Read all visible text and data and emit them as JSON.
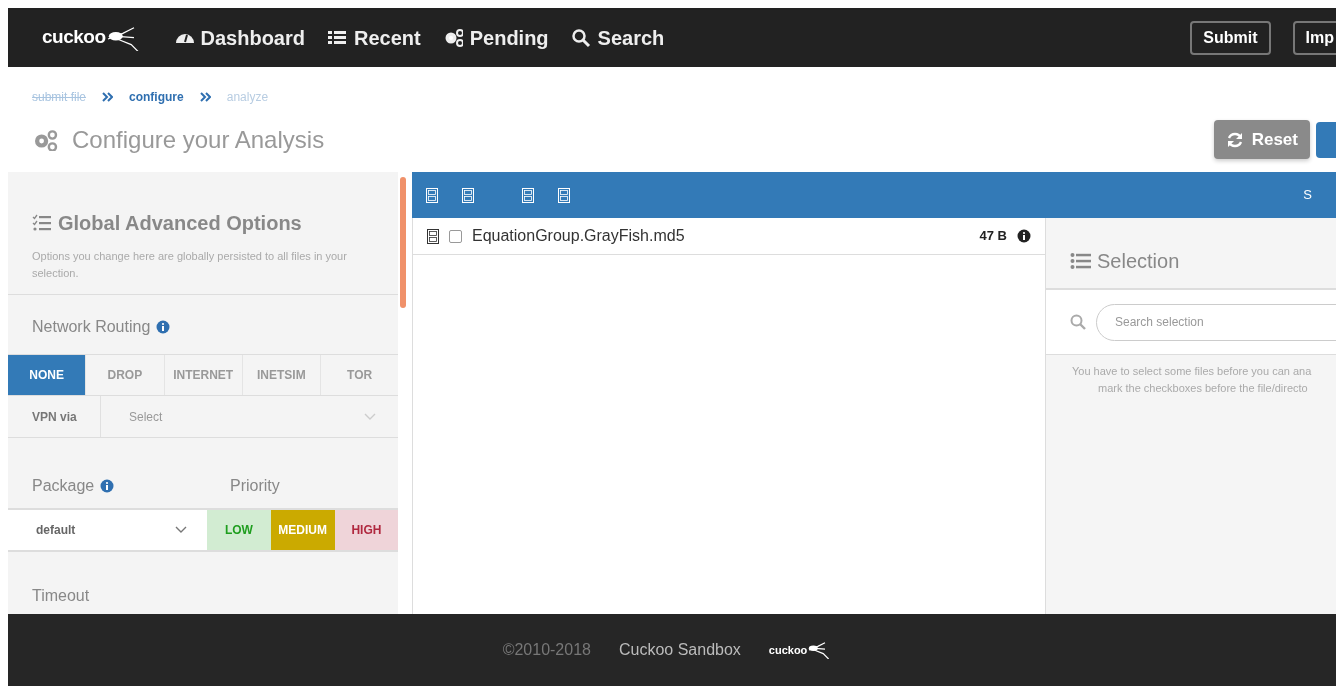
{
  "navbar": {
    "logo": "cuckoo",
    "items": [
      {
        "label": "Dashboard"
      },
      {
        "label": "Recent"
      },
      {
        "label": "Pending"
      },
      {
        "label": "Search"
      }
    ],
    "buttons": [
      "Submit",
      "Imp"
    ]
  },
  "breadcrumb": [
    {
      "label": "submit file",
      "done": true,
      "current": false
    },
    {
      "label": "configure",
      "done": false,
      "current": true
    },
    {
      "label": "analyze",
      "done": false,
      "current": false
    }
  ],
  "page_title": "Configure your Analysis",
  "actions": [
    {
      "kind": "secondary",
      "label": "Reset"
    },
    {
      "kind": "primary"
    }
  ],
  "options": {
    "title": "Global Advanced Options",
    "description": "Options you change here are globally persisted to all files in your selection.",
    "network_routing": {
      "label": "Network Routing",
      "options": [
        {
          "label": "NONE",
          "selected": true
        },
        {
          "label": "DROP",
          "selected": false
        },
        {
          "label": "INTERNET",
          "selected": false
        },
        {
          "label": "INETSIM",
          "selected": false
        },
        {
          "label": "TOR",
          "selected": false
        }
      ]
    },
    "vpn": {
      "label": "VPN via",
      "placeholder": "Select"
    },
    "package": {
      "label": "Package",
      "value": "default"
    },
    "priority": {
      "label": "Priority",
      "options": [
        {
          "label": "LOW",
          "selected": false,
          "color": "#1f9e1f"
        },
        {
          "label": "MEDIUM",
          "selected": true,
          "color": "#cbaa00"
        },
        {
          "label": "HIGH",
          "selected": false,
          "color": "#b0283f"
        }
      ]
    },
    "timeout": {
      "label": "Timeout"
    }
  },
  "file_tree": {
    "header_text": "S",
    "files": [
      {
        "name": "EquationGroup.GrayFish.md5",
        "size": "47 B",
        "checked": false
      }
    ]
  },
  "selection": {
    "title": "Selection",
    "search_placeholder": "Search selection",
    "message_lines": [
      "You have to select some files before you can ana",
      "mark the checkboxes before the file/directo"
    ]
  },
  "footer": {
    "copyright": "©2010-2018",
    "name": "Cuckoo Sandbox",
    "logo": "cuckoo"
  }
}
